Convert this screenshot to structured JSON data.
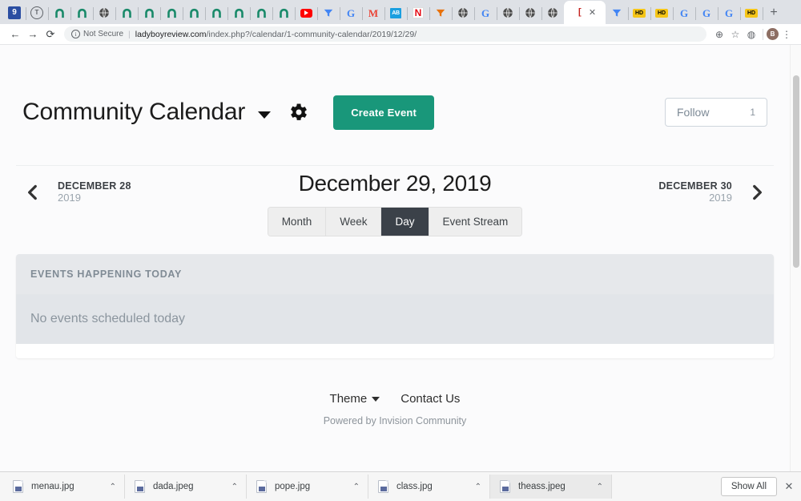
{
  "browser": {
    "tabs": [
      {
        "icon": "blue-9-icon",
        "type": "blue9",
        "label": "9"
      },
      {
        "icon": "t-circle-icon",
        "type": "tcircle",
        "label": "T"
      },
      {
        "icon": "green-arch-icon",
        "type": "arch",
        "label": ""
      },
      {
        "icon": "green-arch-icon",
        "type": "arch",
        "label": ""
      },
      {
        "icon": "globe-icon",
        "type": "globe",
        "label": ""
      },
      {
        "icon": "green-arch-icon",
        "type": "arch",
        "label": ""
      },
      {
        "icon": "green-arch-icon",
        "type": "arch",
        "label": ""
      },
      {
        "icon": "green-arch-icon",
        "type": "arch",
        "label": ""
      },
      {
        "icon": "green-arch-icon",
        "type": "arch",
        "label": ""
      },
      {
        "icon": "green-arch-icon",
        "type": "arch",
        "label": ""
      },
      {
        "icon": "green-arch-icon",
        "type": "arch",
        "label": ""
      },
      {
        "icon": "green-arch-icon",
        "type": "arch",
        "label": ""
      },
      {
        "icon": "green-arch-icon",
        "type": "arch",
        "label": ""
      },
      {
        "icon": "youtube-icon",
        "type": "yt",
        "label": ""
      },
      {
        "icon": "blue-funnel-icon",
        "type": "tri",
        "label": ""
      },
      {
        "icon": "google-icon",
        "type": "g",
        "label": "G"
      },
      {
        "icon": "gmail-icon",
        "type": "m",
        "label": "M"
      },
      {
        "icon": "ab-blue-icon",
        "type": "ab",
        "label": "AB"
      },
      {
        "icon": "netflix-n-icon",
        "type": "n",
        "label": "N"
      },
      {
        "icon": "orange-funnel-icon",
        "type": "tri2",
        "label": ""
      },
      {
        "icon": "globe-icon",
        "type": "globe",
        "label": ""
      },
      {
        "icon": "google-icon",
        "type": "g",
        "label": "G"
      },
      {
        "icon": "globe-icon",
        "type": "globe",
        "label": ""
      },
      {
        "icon": "globe-icon",
        "type": "globe",
        "label": ""
      },
      {
        "icon": "globe-icon",
        "type": "globe",
        "label": ""
      },
      {
        "icon": "bracket-icon",
        "type": "active",
        "label": "["
      },
      {
        "icon": "blue-funnel-icon",
        "type": "tri",
        "label": ""
      },
      {
        "icon": "hd-badge-icon",
        "type": "hd",
        "label": "HD"
      },
      {
        "icon": "hd-badge-icon",
        "type": "hd",
        "label": "HD"
      },
      {
        "icon": "google-icon",
        "type": "g",
        "label": "G"
      },
      {
        "icon": "google-icon",
        "type": "g",
        "label": "G"
      },
      {
        "icon": "google-icon",
        "type": "g",
        "label": "G"
      },
      {
        "icon": "hd-badge-icon",
        "type": "hd",
        "label": "HD"
      }
    ],
    "new_tab_label": "+",
    "toolbar": {
      "back_label": "←",
      "forward_label": "→",
      "reload_label": "⟳",
      "info_label": "i",
      "security_text": "Not Secure",
      "url_host": "ladyboyreview.com",
      "url_path": "/index.php?/calendar/1-community-calendar/2019/12/29/",
      "zoom_label": "⊕",
      "bookmark_label": "☆",
      "profile_label": "◍",
      "avatar_label": "B",
      "menu_label": "⋮"
    }
  },
  "page": {
    "header": {
      "title": "Community Calendar",
      "dropdown_label": "▾",
      "settings_label": "gear",
      "create_event_label": "Create Event",
      "follow_label": "Follow",
      "follow_count": "1"
    },
    "datenav": {
      "prev_arrow": "‹",
      "prev_date": "DECEMBER 28",
      "prev_year": "2019",
      "current_date": "December 29, 2019",
      "next_date": "DECEMBER 30",
      "next_year": "2019",
      "next_arrow": "›",
      "views": [
        {
          "label": "Month",
          "active": false
        },
        {
          "label": "Week",
          "active": false
        },
        {
          "label": "Day",
          "active": true
        },
        {
          "label": "Event Stream",
          "active": false
        }
      ]
    },
    "events_panel": {
      "heading": "EVENTS HAPPENING TODAY",
      "empty_message": "No events scheduled today"
    },
    "footer": {
      "theme_label": "Theme",
      "contact_label": "Contact Us",
      "powered_by": "Powered by Invision Community"
    },
    "colors": {
      "accent_green": "#19977a",
      "active_tab_dark": "#3b4149",
      "panel_header_bg": "#e6e8eb",
      "panel_body_bg": "#e2e5e9"
    }
  },
  "download_shelf": {
    "items": [
      {
        "name": "menau.jpg",
        "active": false
      },
      {
        "name": "dada.jpeg",
        "active": false
      },
      {
        "name": "pope.jpg",
        "active": false
      },
      {
        "name": "class.jpg",
        "active": false
      },
      {
        "name": "theass.jpeg",
        "active": true
      }
    ],
    "caret_label": "⌃",
    "show_all_label": "Show All",
    "close_label": "✕"
  }
}
